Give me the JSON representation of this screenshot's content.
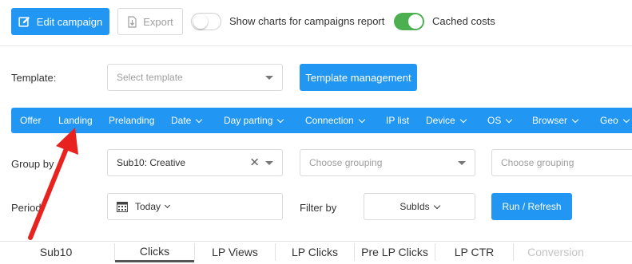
{
  "toolbar": {
    "edit_campaign_label": "Edit campaign",
    "export_label": "Export",
    "show_charts_label": "Show charts for campaigns report",
    "show_charts_on": false,
    "cached_costs_label": "Cached costs",
    "cached_costs_on": true
  },
  "template": {
    "label": "Template:",
    "placeholder": "Select template",
    "management_label": "Template management"
  },
  "nav": {
    "items": [
      {
        "label": "Offer"
      },
      {
        "label": "Landing"
      },
      {
        "label": "Prelanding"
      },
      {
        "label": "Date"
      },
      {
        "label": "Day parting"
      },
      {
        "label": "Connection"
      },
      {
        "label": "IP list"
      },
      {
        "label": "Device"
      },
      {
        "label": "OS"
      },
      {
        "label": "Browser"
      },
      {
        "label": "Geo"
      }
    ]
  },
  "group_by": {
    "label": "Group by",
    "selected": "Sub10: Creative",
    "grouping2_placeholder": "Choose grouping",
    "grouping3_placeholder": "Choose grouping"
  },
  "period": {
    "label": "Period",
    "value": "Today",
    "filter_label": "Filter by",
    "filter_value": "SubIds",
    "run_label": "Run / Refresh"
  },
  "table": {
    "columns": [
      "Sub10",
      "Clicks",
      "LP Views",
      "LP Clicks",
      "Pre LP Clicks",
      "LP CTR",
      "Conversion"
    ],
    "active_column": "Clicks"
  },
  "colors": {
    "primary": "#2196f3",
    "toggle_on": "#4caf50",
    "annotation_arrow": "#e8231f"
  },
  "annotation": {
    "type": "arrow",
    "points_to": "Landing"
  }
}
